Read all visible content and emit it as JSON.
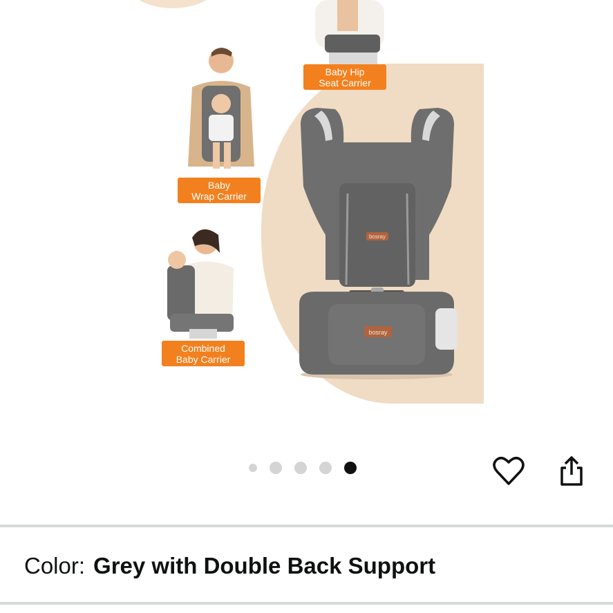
{
  "gallery": {
    "labels": {
      "hip_seat": "Baby Hip\nSeat Carrier",
      "wrap": "Baby\nWrap Carrier",
      "combined": "Combined\nBaby Carrier"
    },
    "brand_tag": "bosray",
    "dots_count": 5,
    "active_dot": 5
  },
  "actions": {
    "wishlist_icon": "heart-icon",
    "share_icon": "share-icon"
  },
  "variant": {
    "label": "Color:",
    "value": "Grey with Double Back Support"
  },
  "colors": {
    "label_bg": "#f3801e",
    "peach": "#f0dcc4",
    "carrier_grey": "#6b6b6b",
    "active_dot": "#0f1111"
  }
}
